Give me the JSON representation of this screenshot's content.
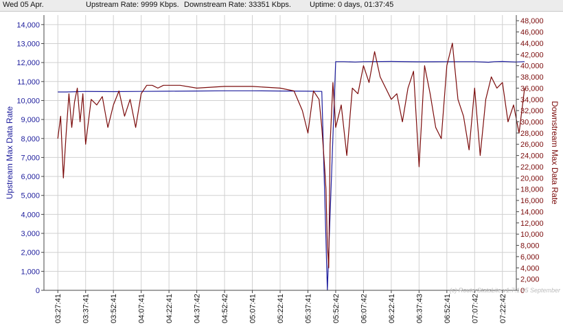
{
  "header": {
    "date": "Wed 05 Apr.",
    "upstream": "Upstream Rate: 9999 Kbps.",
    "downstream": "Downstream Rate: 33351 Kbps.",
    "uptime": "Uptime: 0 days, 01:37:45"
  },
  "watermark": "(c) RouterStatsLite v1.7.1  05 September",
  "colors": {
    "upstream": "#1c1c9c",
    "downstream": "#7a0a0a",
    "grid": "#d0d0d0",
    "axis": "#444444"
  },
  "chart_data": {
    "type": "line",
    "ylabel_left": "Upstream Max Data Rate",
    "ylabel_right": "Downstream Max Data Rate",
    "y_left_range": [
      0,
      14500
    ],
    "y_left_ticks": [
      0,
      1000,
      2000,
      3000,
      4000,
      5000,
      6000,
      7000,
      8000,
      9000,
      10000,
      11000,
      12000,
      13000,
      14000
    ],
    "y_right_range": [
      0,
      49000
    ],
    "y_right_ticks": [
      0,
      2000,
      4000,
      6000,
      8000,
      10000,
      12000,
      14000,
      16000,
      18000,
      20000,
      22000,
      24000,
      26000,
      28000,
      30000,
      32000,
      34000,
      36000,
      38000,
      40000,
      42000,
      44000,
      46000,
      48000
    ],
    "x_ticks": [
      "03:27:41",
      "03:37:41",
      "03:52:41",
      "04:07:41",
      "04:22:41",
      "04:37:42",
      "04:52:42",
      "05:07:41",
      "05:22:41",
      "05:37:41",
      "05:52:42",
      "06:07:42",
      "06:22:41",
      "06:37:43",
      "06:52:41",
      "07:07:42",
      "07:22:42"
    ],
    "grid": true,
    "series": [
      {
        "name": "Upstream Max Data Rate",
        "axis": "left",
        "x": [
          0.0,
          0.3,
          1.0,
          2.0,
          3.0,
          4.0,
          5.0,
          6.0,
          7.0,
          8.0,
          9.0,
          9.5,
          9.7,
          10.0,
          10.3,
          10.7,
          11.0,
          12.0,
          13.0,
          14.0,
          15.0,
          15.5,
          15.7,
          16.0,
          16.5,
          16.8
        ],
        "values": [
          10450,
          10450,
          10480,
          10470,
          10480,
          10490,
          10500,
          10510,
          10510,
          10500,
          10490,
          10480,
          0,
          12050,
          12050,
          12030,
          12050,
          12060,
          12040,
          12050,
          12050,
          12020,
          12050,
          12060,
          12030,
          12050
        ]
      },
      {
        "name": "Downstream Max Data Rate",
        "axis": "right",
        "x": [
          0.0,
          0.1,
          0.2,
          0.3,
          0.4,
          0.5,
          0.6,
          0.7,
          0.8,
          0.9,
          1.0,
          1.2,
          1.4,
          1.6,
          1.8,
          2.0,
          2.2,
          2.4,
          2.6,
          2.8,
          3.0,
          3.2,
          3.4,
          3.6,
          3.8,
          4.0,
          4.4,
          5.0,
          6.0,
          7.0,
          8.0,
          8.5,
          8.8,
          9.0,
          9.2,
          9.4,
          9.5,
          9.6,
          9.65,
          9.7,
          9.75,
          9.8,
          9.9,
          10.0,
          10.2,
          10.4,
          10.6,
          10.8,
          11.0,
          11.2,
          11.4,
          11.6,
          11.8,
          12.0,
          12.2,
          12.4,
          12.6,
          12.8,
          13.0,
          13.2,
          13.4,
          13.6,
          13.8,
          14.0,
          14.2,
          14.4,
          14.6,
          14.8,
          15.0,
          15.2,
          15.4,
          15.6,
          15.8,
          16.0,
          16.2,
          16.4,
          16.6,
          16.8
        ],
        "values": [
          27000,
          31000,
          20000,
          28000,
          35000,
          29000,
          33500,
          36000,
          30000,
          35000,
          26000,
          34000,
          33000,
          34500,
          29000,
          33000,
          35500,
          31000,
          34000,
          29000,
          35000,
          36500,
          36500,
          36000,
          36500,
          36500,
          36500,
          36000,
          36300,
          36300,
          36000,
          35500,
          32000,
          28000,
          35500,
          34000,
          29000,
          22000,
          18000,
          8000,
          4000,
          26000,
          37000,
          29000,
          33000,
          24000,
          36000,
          35000,
          40000,
          37000,
          42500,
          38000,
          36000,
          34000,
          35000,
          30000,
          36000,
          39000,
          22000,
          40000,
          35000,
          29000,
          27000,
          40000,
          44000,
          34000,
          31000,
          25000,
          36000,
          24000,
          34000,
          38000,
          36000,
          37000,
          30000,
          33000,
          28000,
          36000
        ]
      }
    ]
  }
}
